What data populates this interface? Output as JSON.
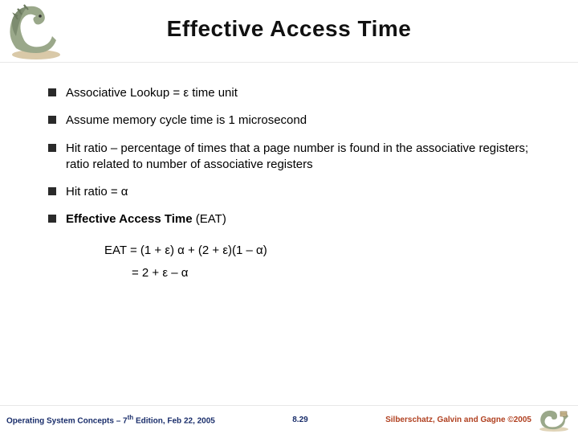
{
  "title": "Effective Access Time",
  "bullets": [
    {
      "prefix": "Associative Lookup = ",
      "sym": "ε",
      "suffix": " time unit",
      "bold": false
    },
    {
      "prefix": "Assume memory cycle time is 1 microsecond",
      "sym": "",
      "suffix": "",
      "bold": false
    },
    {
      "prefix": "Hit ratio – percentage of times that a page number is found in the associative registers; ratio related to number of associative registers",
      "sym": "",
      "suffix": "",
      "bold": false
    },
    {
      "prefix": "Hit ratio = ",
      "sym": "α",
      "suffix": "",
      "bold": false
    },
    {
      "prefix": "Effective Access Time",
      "sym": "",
      "suffix": " (EAT)",
      "bold": true
    }
  ],
  "formula": {
    "line1": "EAT = (1 + ε) α + (2 + ε)(1 – α)",
    "line2": "= 2 + ε – α"
  },
  "footer": {
    "left_a": "Operating System Concepts – 7",
    "left_sup": "th",
    "left_b": " Edition, Feb 22, 2005",
    "mid": "8.29",
    "right": "Silberschatz, Galvin and Gagne ©2005"
  }
}
